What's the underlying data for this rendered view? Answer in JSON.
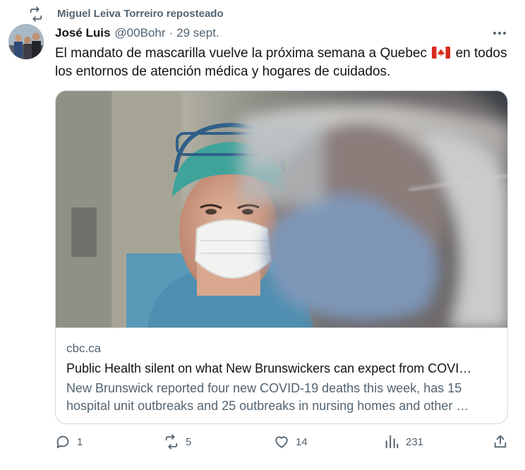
{
  "repost": {
    "icon": "repost-icon",
    "label": "Miguel Leiva Torreiro reposteado"
  },
  "author": {
    "name": "José Luis",
    "handle": "@00Bohr",
    "separator": "·",
    "date": "29 sept."
  },
  "tweet": {
    "text_line1_before_flag": "El mandato de mascarilla vuelve la próxima semana a Quebec",
    "flag_icon": "canada-flag-icon",
    "text_line1_after_flag": "en todos",
    "text_line2": "los entornos de atención médica y hogares de cuidados."
  },
  "card": {
    "domain": "cbc.ca",
    "title": "Public Health silent on what New Brunswickers can expect from COVI…",
    "description_line1": "New Brunswick reported four new COVID-19 deaths this week, has 15",
    "description_line2": "hospital unit outbreaks and 25 outbreaks in nursing homes and other …"
  },
  "actions": {
    "reply": {
      "icon": "reply-icon",
      "count": "1"
    },
    "repost": {
      "icon": "repost-icon",
      "count": "5"
    },
    "like": {
      "icon": "heart-icon",
      "count": "14"
    },
    "views": {
      "icon": "views-icon",
      "count": "231"
    },
    "share": {
      "icon": "share-icon"
    }
  },
  "colors": {
    "text": "#0f1419",
    "secondary": "#536471",
    "border": "#cfd9de",
    "background": "#ffffff"
  }
}
